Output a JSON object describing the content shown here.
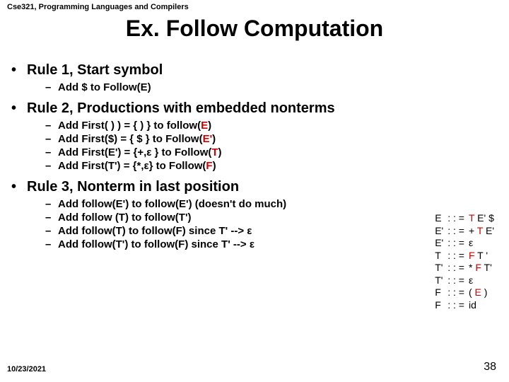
{
  "header": "Cse321, Programming Languages and Compilers",
  "title": "Ex. Follow Computation",
  "bullets": {
    "r1": {
      "title": "Rule 1, Start symbol",
      "items": [
        {
          "text": "Add $ to Follow(E)"
        }
      ]
    },
    "r2": {
      "title": "Rule 2, Productions with embedded nonterms",
      "items": [
        {
          "pre": "Add First( ) ) = { ) }  to follow(",
          "hi": "E",
          "post": ")"
        },
        {
          "pre": "Add First($)  = { $ }  to Follow(",
          "hi": "E'",
          "post": ")"
        },
        {
          "pre": "Add First(E') = {+,ε } to Follow(",
          "hi": "T",
          "post": ")"
        },
        {
          "pre": "Add First(T') = {*,ε} to Follow(",
          "hi": "F",
          "post": ")"
        }
      ]
    },
    "r3": {
      "title": "Rule 3, Nonterm in last position",
      "items": [
        {
          "text": "Add follow(E') to follow(E')     (doesn't do much)"
        },
        {
          "text": "Add follow (T) to follow(T')"
        },
        {
          "text": "Add follow(T) to follow(F)  since T' --> ε"
        },
        {
          "text": "Add follow(T') to follow(F) since T' --> ε"
        }
      ]
    }
  },
  "grammar": [
    {
      "lhs": "E",
      "rhs_pre": "",
      "rhs_hi": "T",
      "rhs_post": " E' $"
    },
    {
      "lhs": "E'",
      "rhs_pre": "+ ",
      "rhs_hi": "T",
      "rhs_post": " E'"
    },
    {
      "lhs": "E'",
      "rhs_pre": "ε",
      "rhs_hi": "",
      "rhs_post": ""
    },
    {
      "lhs": "T",
      "rhs_pre": "",
      "rhs_hi": "F",
      "rhs_post": " T '"
    },
    {
      "lhs": "T'",
      "rhs_pre": "* ",
      "rhs_hi": "F",
      "rhs_post": " T'"
    },
    {
      "lhs": "T'",
      "rhs_pre": "ε",
      "rhs_hi": "",
      "rhs_post": ""
    },
    {
      "lhs": "F",
      "rhs_pre": "( ",
      "rhs_hi": "E",
      "rhs_post": " )"
    },
    {
      "lhs": "F",
      "rhs_pre": "id",
      "rhs_hi": "",
      "rhs_post": ""
    }
  ],
  "grammar_op": ": : =",
  "footer": {
    "date": "10/23/2021",
    "page": "38"
  },
  "bullet_dot": "•",
  "bullet_dash": "–"
}
